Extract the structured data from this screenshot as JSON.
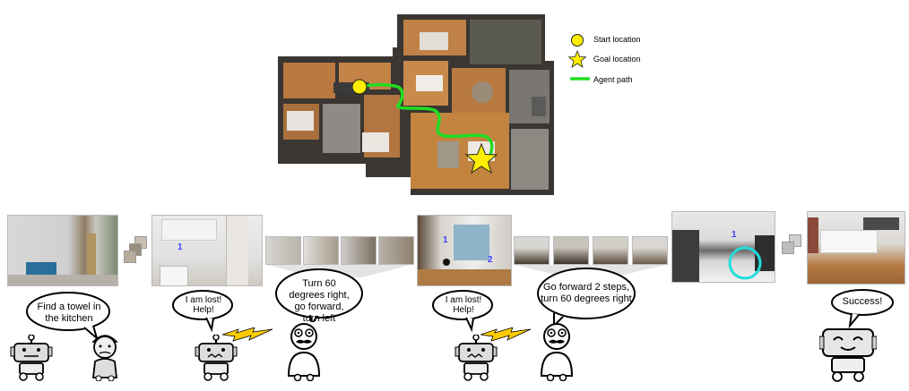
{
  "legend": {
    "start_label": "Start location",
    "goal_label": "Goal location",
    "path_label": "Agent path",
    "start_color": "#ffee00",
    "goal_color": "#ffee00",
    "path_color": "#22dd22"
  },
  "bubbles": {
    "instruction": "Find a towel in the kitchen",
    "lost_1": "I am lost! Help!",
    "help_1": "Turn 60 degrees right, go forward, turn left",
    "lost_2": "I am lost! Help!",
    "help_2": "Go forward 2 steps, turn 60 degrees right",
    "success": "Success!"
  },
  "photo_markers": {
    "p2": "1",
    "p3a": "1",
    "p3b": "2",
    "p4": "1"
  },
  "icons": {
    "robot": "robot-icon",
    "human": "human-helper-icon",
    "lightning": "lightning-icon",
    "target": "target-circle-icon"
  },
  "colors": {
    "target_circle": "#22dddd",
    "lightning": "#ffcc00"
  }
}
